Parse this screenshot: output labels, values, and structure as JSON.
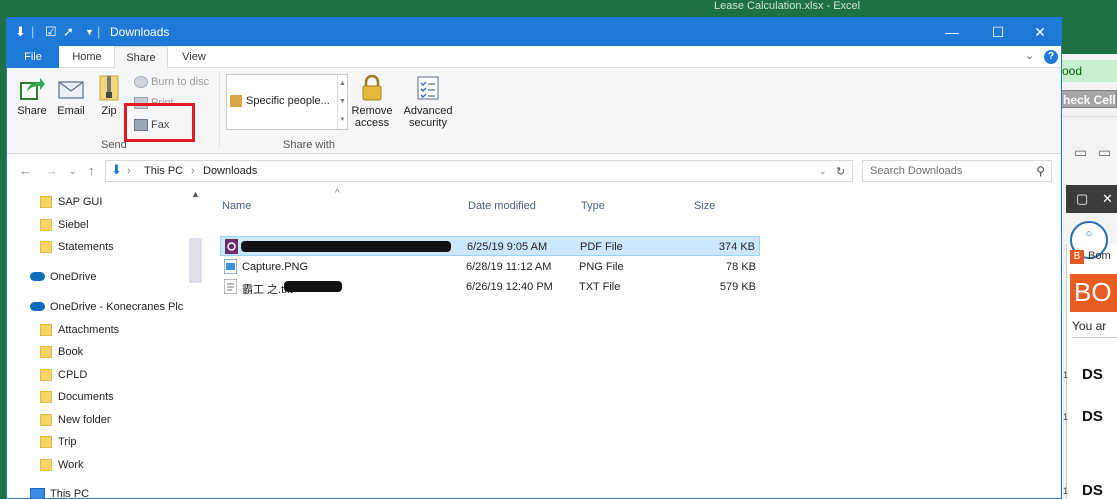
{
  "background": {
    "excel_title": "Lease Calculation.xlsx  -  Excel",
    "cell_good": "ood",
    "cell_check": "heck Cell",
    "addin_label": "Bom",
    "addin_banner": "BO",
    "you_are": "You ar",
    "ds_labels": [
      "DS",
      "DS",
      "DS"
    ]
  },
  "titlebar": {
    "title": "Downloads",
    "minimize": "—",
    "maximize": "☐",
    "close": "✕"
  },
  "ribbon_tabs": {
    "file": "File",
    "home": "Home",
    "share": "Share",
    "view": "View"
  },
  "ribbon": {
    "send": {
      "share": "Share",
      "email": "Email",
      "zip": "Zip",
      "burn": "Burn to disc",
      "print": "Print",
      "fax": "Fax",
      "group_label": "Send"
    },
    "share_with": {
      "gallery_item": "Specific people...",
      "remove_access_l1": "Remove",
      "remove_access_l2": "access",
      "advanced_l1": "Advanced",
      "advanced_l2": "security",
      "group_label": "Share with"
    }
  },
  "address": {
    "crumbs": [
      "This PC",
      "Downloads"
    ],
    "search_placeholder": "Search Downloads"
  },
  "nav": {
    "items": [
      {
        "label": "SAP GUI",
        "type": "folder"
      },
      {
        "label": "Siebel",
        "type": "folder"
      },
      {
        "label": "Statements",
        "type": "folder"
      },
      {
        "label": "OneDrive",
        "type": "cloud"
      },
      {
        "label": "OneDrive - Konecranes Plc",
        "type": "cloud"
      },
      {
        "label": "Attachments",
        "type": "folder"
      },
      {
        "label": "Book",
        "type": "folder"
      },
      {
        "label": "CPLD",
        "type": "folder"
      },
      {
        "label": "Documents",
        "type": "folder"
      },
      {
        "label": "New folder",
        "type": "folder"
      },
      {
        "label": "Trip",
        "type": "folder"
      },
      {
        "label": "Work",
        "type": "folder"
      },
      {
        "label": "This PC",
        "type": "pc"
      }
    ]
  },
  "files": {
    "columns": {
      "name": "Name",
      "date": "Date modified",
      "type": "Type",
      "size": "Size"
    },
    "rows": [
      {
        "name": "",
        "date": "6/25/19 9:05 AM",
        "type": "PDF File",
        "size": "374 KB"
      },
      {
        "name": "Capture.PNG",
        "date": "6/28/19 11:12 AM",
        "type": "PNG File",
        "size": "78 KB"
      },
      {
        "name": "霸工          之.txt",
        "date": "6/26/19 12:40 PM",
        "type": "TXT File",
        "size": "579 KB"
      }
    ]
  },
  "colors": {
    "titlebar": "#1e7ad6",
    "excel_green": "#1e7145",
    "highlight_red": "#e21b22",
    "selection": "#cce8ff"
  }
}
